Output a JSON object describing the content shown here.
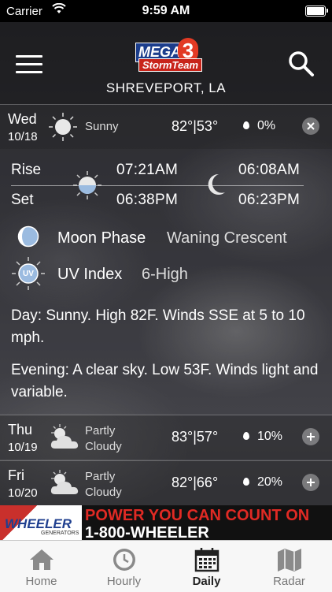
{
  "status_bar": {
    "carrier": "Carrier",
    "time": "9:59 AM"
  },
  "header": {
    "city": "SHREVEPORT, LA",
    "logo_top": "MEGA",
    "logo_number": "3",
    "logo_bottom": "StormTeam"
  },
  "days": [
    {
      "name": "Wed",
      "date": "10/18",
      "condition": "Sunny",
      "high": "82°",
      "low": "53°",
      "separator": "|",
      "precip": "0%",
      "icon": "sun-icon",
      "expanded": true
    },
    {
      "name": "Thu",
      "date": "10/19",
      "condition_line1": "Partly",
      "condition_line2": "Cloudy",
      "high": "83°",
      "low": "57°",
      "separator": "|",
      "precip": "10%",
      "icon": "partly-cloudy-icon",
      "expanded": false
    },
    {
      "name": "Fri",
      "date": "10/20",
      "condition_line1": "Partly",
      "condition_line2": "Cloudy",
      "high": "82°",
      "low": "66°",
      "separator": "|",
      "precip": "20%",
      "icon": "partly-cloudy-icon",
      "expanded": false
    }
  ],
  "detail": {
    "rise_label": "Rise",
    "set_label": "Set",
    "sunrise": "07:21AM",
    "sunset": "06:38PM",
    "moonrise": "06:08AM",
    "moonset": "06:23PM",
    "moon_phase_label": "Moon Phase",
    "moon_phase_value": "Waning Crescent",
    "uv_label": "UV Index",
    "uv_value": "6-High",
    "uv_badge": "UV",
    "day_text": "Day: Sunny. High 82F. Winds SSE at 5 to 10 mph.",
    "evening_text": "Evening: A clear sky. Low 53F. Winds light and variable."
  },
  "ad": {
    "brand": "WHEELER",
    "brand_sub": "GENERATORS",
    "headline": "POWER YOU CAN COUNT ON",
    "phone": "1-800-WHEELER"
  },
  "tabs": [
    {
      "label": "Home",
      "icon": "home-icon"
    },
    {
      "label": "Hourly",
      "icon": "clock-icon"
    },
    {
      "label": "Daily",
      "icon": "calendar-icon",
      "active": true
    },
    {
      "label": "Radar",
      "icon": "map-icon"
    }
  ],
  "colors": {
    "accent_red": "#e02a24",
    "logo_blue": "#1b3d8c",
    "tab_bg": "#f7f7f7"
  }
}
